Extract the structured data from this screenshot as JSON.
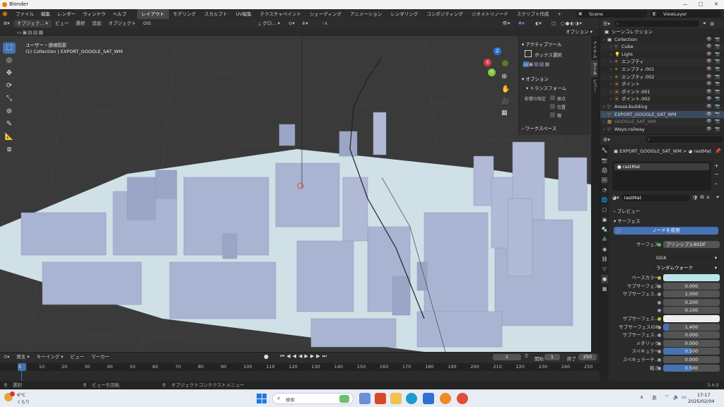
{
  "titlebar": {
    "app_title": "Blender"
  },
  "menubar": {
    "menus": [
      "ファイル",
      "編集",
      "レンダー",
      "ウィンドウ",
      "ヘルプ"
    ],
    "workspaces": [
      "レイアウト",
      "モデリング",
      "スカルプト",
      "UV編集",
      "テクスチャペイント",
      "シェーディング",
      "アニメーション",
      "レンダリング",
      "コンポジティング",
      "ジオメトリノード",
      "スクリプト作成"
    ],
    "add_tab": "+",
    "scene": "Scene",
    "view_layer": "ViewLayer"
  },
  "viewport_header": {
    "mode": "オブジェク...",
    "menus": [
      "ビュー",
      "選択",
      "追加",
      "オブジェクト",
      "GIS"
    ],
    "orientation": "グロ...",
    "options": "オプション"
  },
  "viewport": {
    "view_name": "ユーザー・透視投影",
    "collection_info": "(1) Collection | EXPORT_GOOGLE_SAT_WM",
    "axis_x": "X",
    "axis_y": "Y",
    "axis_z": "Z"
  },
  "npanel": {
    "active_tool_title": "アクティブツール",
    "box_select": "ボックス選択",
    "options_title": "オプション",
    "transform_title": "トランスフォーム",
    "affect_only": "影響の限定",
    "origin": "原点",
    "location": "位置",
    "parent": "親",
    "workspace_title": "ワークスペース",
    "tabs": [
      "アイテム",
      "ツール",
      "ビュー"
    ]
  },
  "timeline": {
    "menus": [
      "再生",
      "キーイング",
      "ビュー",
      "マーカー"
    ],
    "current_frame": "1",
    "start_label": "開始",
    "start": "1",
    "end_label": "終了",
    "end": "250",
    "ticks": [
      "1",
      "10",
      "20",
      "30",
      "40",
      "50",
      "60",
      "70",
      "80",
      "90",
      "100",
      "110",
      "120",
      "130",
      "140",
      "150",
      "160",
      "170",
      "180",
      "190",
      "200",
      "210",
      "220",
      "230",
      "240",
      "250"
    ]
  },
  "statusbar": {
    "select": "選択",
    "rotate_view": "ビューを回転",
    "context_menu": "オブジェクトコンテクストメニュー",
    "version": "3.4.0"
  },
  "outliner": {
    "root": "シーンコレクション",
    "items": [
      {
        "name": "Collection",
        "level": 0
      },
      {
        "name": "Cube",
        "level": 1
      },
      {
        "name": "Light",
        "level": 1
      },
      {
        "name": "エンプティ",
        "level": 1
      },
      {
        "name": "エンプティ.001",
        "level": 1
      },
      {
        "name": "エンプティ.002",
        "level": 1
      },
      {
        "name": "ポイント",
        "level": 1
      },
      {
        "name": "ポイント.001",
        "level": 1
      },
      {
        "name": "ポイント.002",
        "level": 1
      },
      {
        "name": "Areas:building",
        "level": 0
      },
      {
        "name": "EXPORT_GOOGLE_SAT_WM",
        "level": 0
      },
      {
        "name": "GOOGLE_SAT_WM",
        "level": 0
      },
      {
        "name": "Ways:railway",
        "level": 0
      }
    ]
  },
  "properties": {
    "breadcrumb_object": "EXPORT_GOOGLE_SAT_WM",
    "breadcrumb_sep": ">",
    "breadcrumb_material": "rastMat",
    "slot_name": "rastMat",
    "material_name": "rastMat",
    "preview_title": "プレビュー",
    "surface_title": "サーフェス",
    "use_nodes": "ノードを使用",
    "surface_label": "サーフェス",
    "surface_value": "プリンシプルBSDF",
    "distribution": "GGX",
    "subsurface_method": "ランダムウォーク",
    "rows": [
      {
        "label": "ベースカラー",
        "value": ""
      },
      {
        "label": "サブサーフェス",
        "value": "0.000"
      },
      {
        "label": "サブサーフェス...",
        "value": "1.000"
      },
      {
        "label": "",
        "value": "0.200"
      },
      {
        "label": "",
        "value": "0.100"
      },
      {
        "label": "サブサーフェス...",
        "value": ""
      },
      {
        "label": "サブサーフェスIOR",
        "value": "1.400"
      },
      {
        "label": "サブサーフェス...",
        "value": "0.000"
      },
      {
        "label": "メタリック",
        "value": "0.000"
      },
      {
        "label": "スペキュラー",
        "value": "0.500"
      },
      {
        "label": "スペキュラーチ...",
        "value": "0.000"
      },
      {
        "label": "粗さ",
        "value": "0.500"
      }
    ]
  },
  "taskbar": {
    "weather_temp": "6°C",
    "weather_desc": "くもり",
    "search_placeholder": "検索",
    "time": "17:17",
    "date": "2025/02/04"
  },
  "colors": {
    "accent": "#4772b3",
    "active_tab": "#474747",
    "base_color_swatch": "#b9e6ea",
    "city_blocks": "#a9b4d3",
    "ground": "#cfe0e6"
  }
}
